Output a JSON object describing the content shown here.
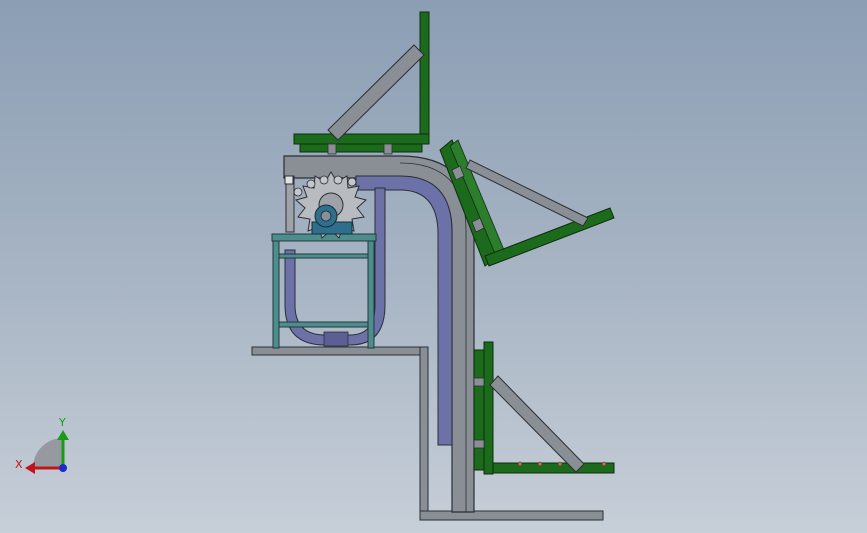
{
  "colors": {
    "background_top": "#8b9eb4",
    "background_bottom": "#c7cfd8",
    "frame_steel": "#8a8f96",
    "frame_outline": "#2b2f34",
    "green_channel": "#1c6a1c",
    "green_outline": "#0d2e0d",
    "blue_conveyor": "#6c72a8",
    "teal_stand": "#4f8c8c",
    "bearing_block": "#2f6f8c",
    "axis_x": "#c0141c",
    "axis_y": "#1a9a1a",
    "axis_z": "#1c2cc8"
  },
  "triad": {
    "x_label": "X",
    "y_label": "Y"
  }
}
